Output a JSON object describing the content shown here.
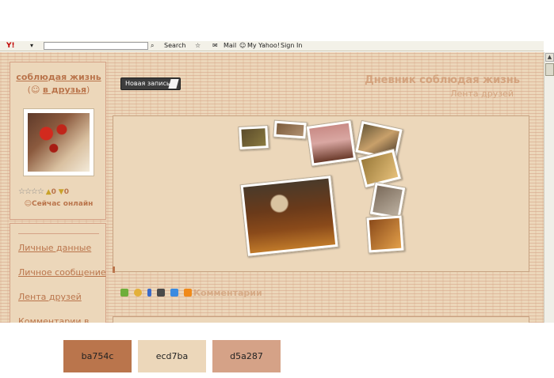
{
  "toolbar": {
    "logo": "Y!",
    "search_label": "Search",
    "mail_label": "Mail",
    "my_yahoo_label": "My Yahoo!",
    "sign_in_label": "Sign In"
  },
  "profile": {
    "name": "соблюдая жизнь",
    "add_friend": "в друзья",
    "rating_count_up": "0",
    "rating_count_down": "0",
    "online_status": "Сейчас онлайн"
  },
  "nav": {
    "items": [
      {
        "label": "Личные данные"
      },
      {
        "label": "Личное сообщение"
      },
      {
        "label": "Лента друзей"
      },
      {
        "label": "Комментарии в"
      }
    ]
  },
  "header": {
    "new_post_button": "Новая запись",
    "diary_title": "Дневник соблюдая жизнь",
    "diary_subtitle": "Лента друзей"
  },
  "post": {
    "comments_label": "Комментарии"
  },
  "palette": {
    "swatches": [
      {
        "hex": "#ba754c",
        "label": "ba754c"
      },
      {
        "hex": "#ecd7ba",
        "label": "ecd7ba"
      },
      {
        "hex": "#d5a287",
        "label": "d5a287"
      }
    ]
  },
  "colors": {
    "accent": "#ba754c",
    "background": "#ecd7ba",
    "border": "#d5a287"
  }
}
